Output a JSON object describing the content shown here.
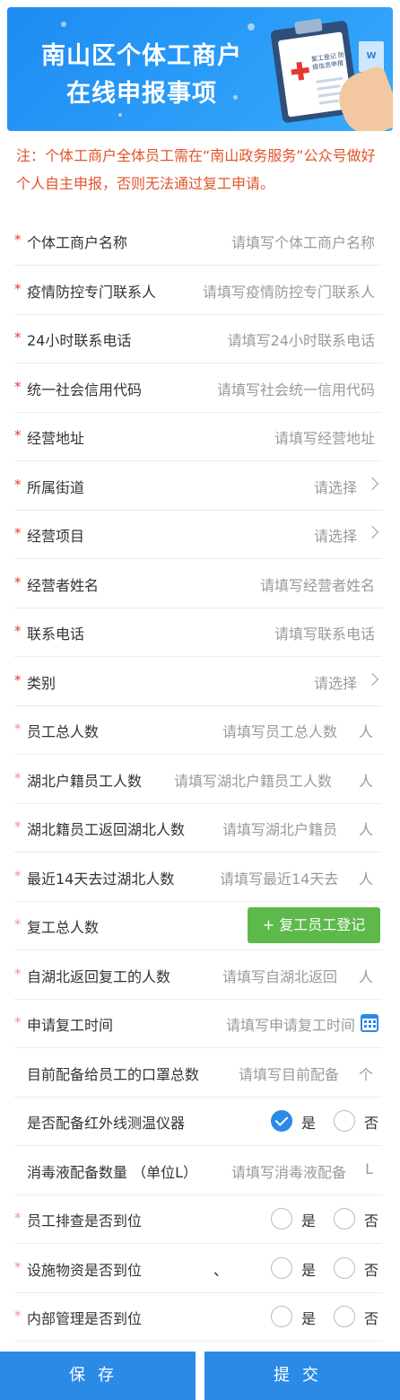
{
  "banner": {
    "title_line1": "南山区个体工商户",
    "title_line2": "在线申报事项",
    "paper_text": "复工登记 防疫信息申报",
    "doc_letter": "W"
  },
  "notice": "注：个体工商户全体员工需在“南山政务服务”公众号做好个人自主申报，否则无法通过复工申请。",
  "fields": [
    {
      "label": "个体工商户名称",
      "placeholder": "请填写个体工商户名称"
    },
    {
      "label": "疫情防控专门联系人",
      "placeholder": "请填写疫情防控专门联系人"
    },
    {
      "label": "24小时联系电话",
      "placeholder": "请填写24小时联系电话"
    },
    {
      "label": "统一社会信用代码",
      "placeholder": "请填写社会统一信用代码"
    },
    {
      "label": "经营地址",
      "placeholder": "请填写经营地址"
    },
    {
      "label": "所属街道",
      "placeholder": "请选择"
    },
    {
      "label": "经营项目",
      "placeholder": "请选择"
    },
    {
      "label": "经营者姓名",
      "placeholder": "请填写经营者姓名"
    },
    {
      "label": "联系电话",
      "placeholder": "请填写联系电话"
    },
    {
      "label": "类别",
      "placeholder": "请选择"
    },
    {
      "label": "员工总人数",
      "placeholder": "请填写员工总人数",
      "unit": "人"
    },
    {
      "label": "湖北户籍员工人数",
      "placeholder": "请填写湖北户籍员工人数",
      "unit": "人"
    },
    {
      "label": "湖北籍员工返回湖北人数",
      "placeholder": "请填写湖北户籍员",
      "unit": "人"
    },
    {
      "label": "最近14天去过湖北人数",
      "placeholder": "请填写最近14天去",
      "unit": "人"
    },
    {
      "label": "复工总人数",
      "button": "+ 复工员工登记"
    },
    {
      "label": "自湖北返回复工的人数",
      "placeholder": "请填写自湖北返回",
      "unit": "人"
    },
    {
      "label": "申请复工时间",
      "placeholder": "请填写申请复工时间"
    },
    {
      "label": "目前配备给员工的口罩总数",
      "placeholder": "请填写目前配备",
      "unit": "个"
    },
    {
      "label": "是否配备红外线测温仪器",
      "yes": "是",
      "no": "否",
      "selected": "是"
    },
    {
      "label": "消毒液配备数量 （单位L）",
      "placeholder": "请填写消毒液配备",
      "unit": "L"
    },
    {
      "label": "员工排查是否到位",
      "yes": "是",
      "no": "否"
    },
    {
      "label": "设施物资是否到位",
      "yes": "是",
      "no": "否",
      "extra": "、"
    },
    {
      "label": "内部管理是否到位",
      "yes": "是",
      "no": "否"
    }
  ],
  "buttons": {
    "save": "保存",
    "submit": "提交"
  },
  "colors": {
    "primary": "#2b8ae6",
    "green": "#5cb94a",
    "required": "#e53935",
    "notice": "#e0542a"
  }
}
